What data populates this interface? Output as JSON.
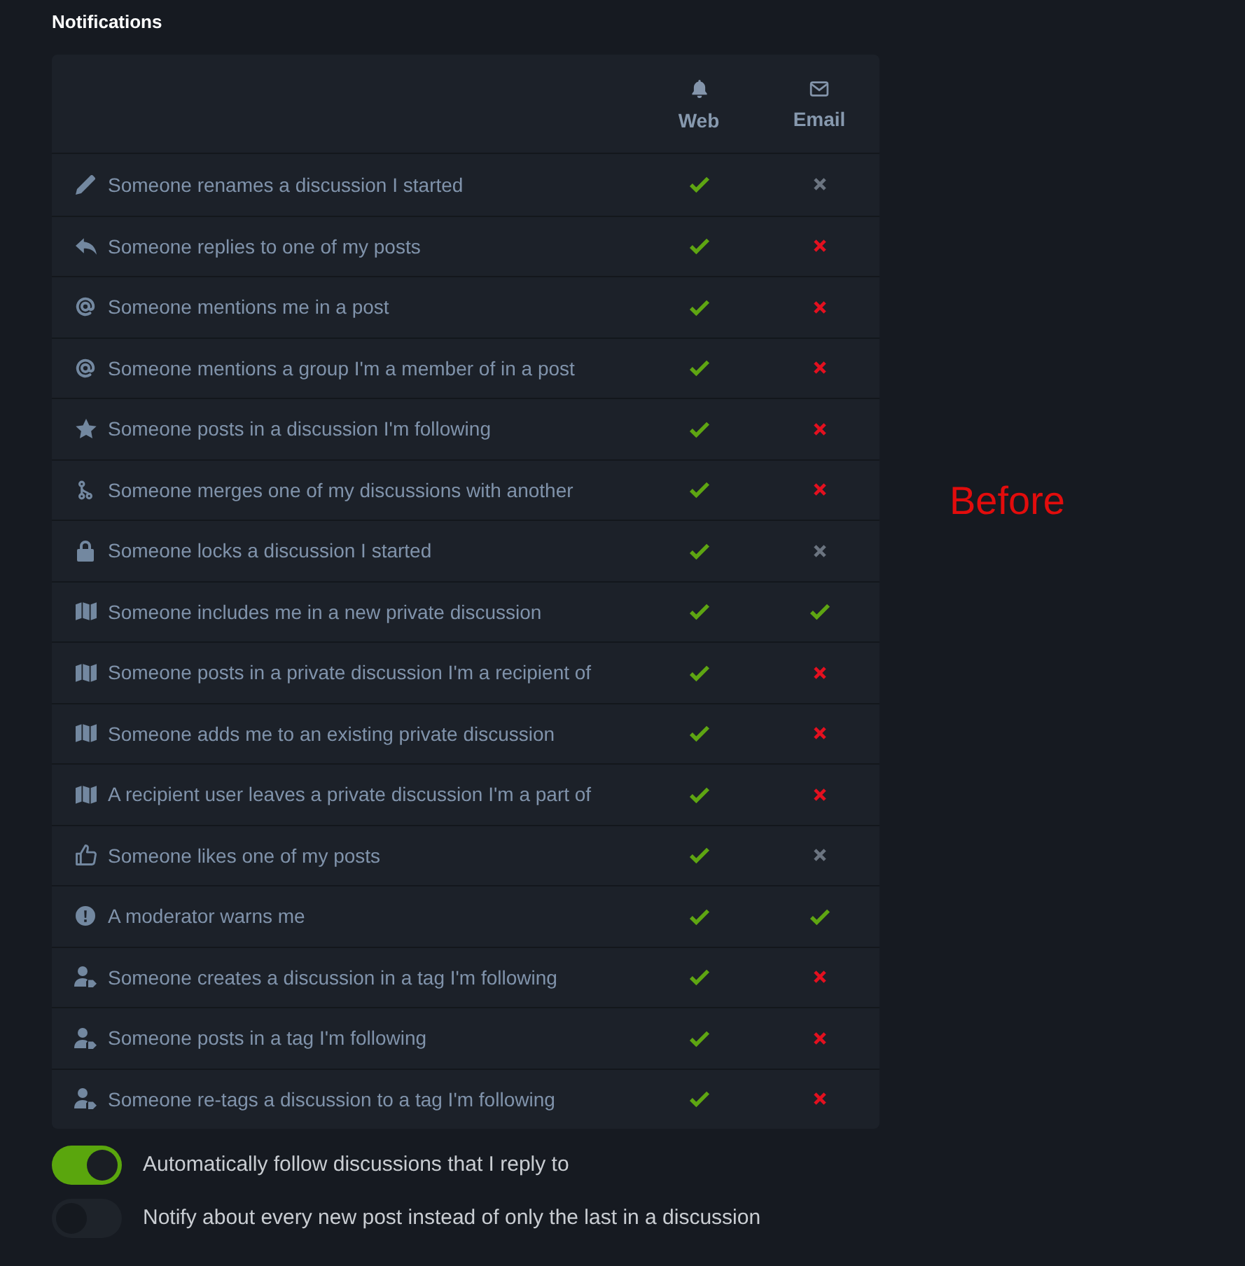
{
  "title": "Notifications",
  "columns": [
    {
      "kind": "web",
      "label": "Web"
    },
    {
      "kind": "email",
      "label": "Email"
    }
  ],
  "rows": [
    {
      "kind": "rename",
      "label": "Someone renames a discussion I started",
      "cells": [
        {
          "checked": true,
          "disabled": false
        },
        {
          "checked": false,
          "disabled": true
        }
      ]
    },
    {
      "kind": "reply",
      "label": "Someone replies to one of my posts",
      "cells": [
        {
          "checked": true,
          "disabled": false
        },
        {
          "checked": false,
          "disabled": false
        }
      ]
    },
    {
      "kind": "mention",
      "label": "Someone mentions me in a post",
      "cells": [
        {
          "checked": true,
          "disabled": false
        },
        {
          "checked": false,
          "disabled": false
        }
      ]
    },
    {
      "kind": "mention",
      "label": "Someone mentions a group I'm a member of in a post",
      "cells": [
        {
          "checked": true,
          "disabled": false
        },
        {
          "checked": false,
          "disabled": false
        }
      ]
    },
    {
      "kind": "following",
      "label": "Someone posts in a discussion I'm following",
      "cells": [
        {
          "checked": true,
          "disabled": false
        },
        {
          "checked": false,
          "disabled": false
        }
      ]
    },
    {
      "kind": "merge",
      "label": "Someone merges one of my discussions with another",
      "cells": [
        {
          "checked": true,
          "disabled": false
        },
        {
          "checked": false,
          "disabled": false
        }
      ]
    },
    {
      "kind": "lock",
      "label": "Someone locks a discussion I started",
      "cells": [
        {
          "checked": true,
          "disabled": false
        },
        {
          "checked": false,
          "disabled": true
        }
      ]
    },
    {
      "kind": "private",
      "label": "Someone includes me in a new private discussion",
      "cells": [
        {
          "checked": true,
          "disabled": false
        },
        {
          "checked": true,
          "disabled": false
        }
      ]
    },
    {
      "kind": "private",
      "label": "Someone posts in a private discussion I'm a recipient of",
      "cells": [
        {
          "checked": true,
          "disabled": false
        },
        {
          "checked": false,
          "disabled": false
        }
      ]
    },
    {
      "kind": "private",
      "label": "Someone adds me to an existing private discussion",
      "cells": [
        {
          "checked": true,
          "disabled": false
        },
        {
          "checked": false,
          "disabled": false
        }
      ]
    },
    {
      "kind": "private",
      "label": "A recipient user leaves a private discussion I'm a part of",
      "cells": [
        {
          "checked": true,
          "disabled": false
        },
        {
          "checked": false,
          "disabled": false
        }
      ]
    },
    {
      "kind": "like",
      "label": "Someone likes one of my posts",
      "cells": [
        {
          "checked": true,
          "disabled": false
        },
        {
          "checked": false,
          "disabled": true
        }
      ]
    },
    {
      "kind": "warning",
      "label": "A moderator warns me",
      "cells": [
        {
          "checked": true,
          "disabled": false
        },
        {
          "checked": true,
          "disabled": false
        }
      ]
    },
    {
      "kind": "tag",
      "label": "Someone creates a discussion in a tag I'm following",
      "cells": [
        {
          "checked": true,
          "disabled": false
        },
        {
          "checked": false,
          "disabled": false
        }
      ]
    },
    {
      "kind": "tag",
      "label": "Someone posts in a tag I'm following",
      "cells": [
        {
          "checked": true,
          "disabled": false
        },
        {
          "checked": false,
          "disabled": false
        }
      ]
    },
    {
      "kind": "tag",
      "label": "Someone re-tags a discussion to a tag I'm following",
      "cells": [
        {
          "checked": true,
          "disabled": false
        },
        {
          "checked": false,
          "disabled": false
        }
      ]
    }
  ],
  "switches": [
    {
      "label": "Automatically follow discussions that I reply to",
      "on": true
    },
    {
      "label": "Notify about every new post instead of only the last in a discussion",
      "on": false
    }
  ],
  "annotation": "Before"
}
